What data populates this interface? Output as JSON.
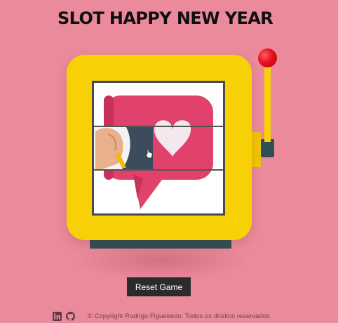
{
  "page": {
    "title": "SLOT HAPPY NEW YEAR"
  },
  "slot_machine": {
    "reels": [
      {
        "symbol": "chat-bubble-heart-icon"
      },
      {
        "symbol": "hand-pointing-icon"
      },
      {
        "symbol": "chat-bubble-heart-icon"
      }
    ],
    "colors": {
      "background": "#ea8a9a",
      "cabinet": "#f7d106",
      "base": "#2f4f56",
      "lever_ball": "#e60f1e",
      "bubble": "#e0426b"
    }
  },
  "controls": {
    "reset_label": "Reset Game"
  },
  "footer": {
    "icons": [
      "linkedin-icon",
      "github-icon"
    ],
    "copyright": "© Copyright Rodrigo Figueiredo. Todos os direitos reservados"
  }
}
